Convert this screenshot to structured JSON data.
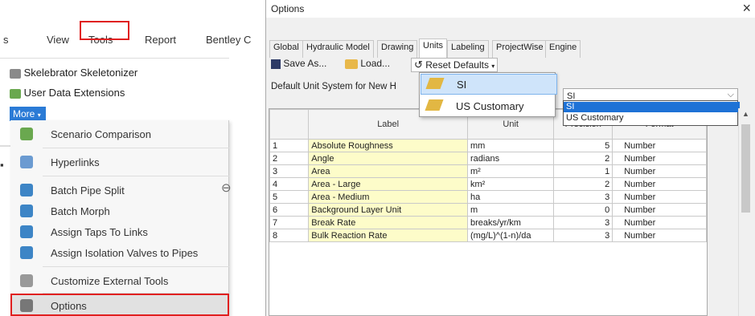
{
  "ribbon": {
    "tabs": [
      "s",
      "View",
      "Tools",
      "Report",
      "Bentley C"
    ],
    "items": [
      "Skelebrator Skeletonizer",
      "User Data Extensions"
    ],
    "more_label": "More",
    "menu": [
      {
        "label": "Scenario Comparison",
        "icon": "scenario-comparison-icon",
        "color": "#6aa84f"
      },
      {
        "label": "Hyperlinks",
        "icon": "hyperlinks-icon",
        "color": "#3d85c6"
      },
      {
        "label": "Batch Pipe Split",
        "icon": "batch-pipe-split-icon",
        "color": "#3d85c6"
      },
      {
        "label": "Batch Morph",
        "icon": "batch-morph-icon",
        "color": "#3d85c6"
      },
      {
        "label": "Assign Taps To Links",
        "icon": "assign-taps-icon",
        "color": "#3d85c6"
      },
      {
        "label": "Assign Isolation Valves to Pipes",
        "icon": "isolation-valves-icon",
        "color": "#3d85c6"
      },
      {
        "label": "Customize External Tools",
        "icon": "customize-tools-icon",
        "color": "#888888"
      },
      {
        "label": "Options",
        "icon": "options-icon",
        "color": "#666666"
      }
    ]
  },
  "dialog": {
    "title": "Options",
    "close": "×",
    "tabs": [
      "Global",
      "Hydraulic Model",
      "Drawing",
      "Units",
      "Labeling",
      "ProjectWise",
      "Engine"
    ],
    "active_tab": "Units",
    "toolbar": {
      "save_as": "Save As...",
      "load": "Load...",
      "reset": "Reset Defaults"
    },
    "default_unit_label": "Default Unit System for New H",
    "unit_popup": [
      "SI",
      "US Customary"
    ],
    "select": {
      "value": "SI",
      "options": [
        "SI",
        "US Customary"
      ]
    },
    "table": {
      "headers": [
        "Label",
        "Unit",
        "Precision",
        "Format"
      ],
      "rows": [
        [
          "1",
          "Absolute Roughness",
          "mm",
          "5",
          "Number"
        ],
        [
          "2",
          "Angle",
          "radians",
          "2",
          "Number"
        ],
        [
          "3",
          "Area",
          "m²",
          "1",
          "Number"
        ],
        [
          "4",
          "Area - Large",
          "km²",
          "2",
          "Number"
        ],
        [
          "5",
          "Area - Medium",
          "ha",
          "3",
          "Number"
        ],
        [
          "6",
          "Background Layer Unit",
          "m",
          "0",
          "Number"
        ],
        [
          "7",
          "Break Rate",
          "breaks/yr/km",
          "3",
          "Number"
        ],
        [
          "8",
          "Bulk Reaction Rate",
          "(mg/L)^(1-n)/da",
          "3",
          "Number"
        ]
      ]
    }
  },
  "colors": {
    "highlight_red": "#e02020",
    "accent_blue": "#2b7bd6",
    "label_cell": "#fdfcc9"
  }
}
